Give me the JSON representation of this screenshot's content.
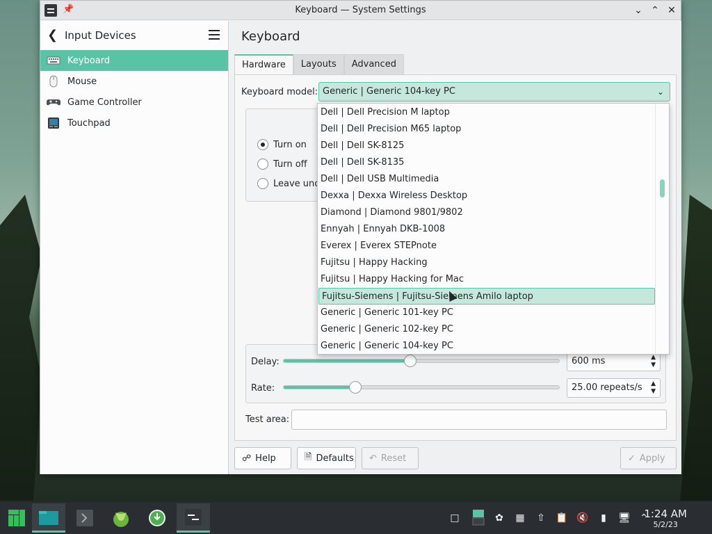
{
  "window": {
    "title": "Keyboard — System Settings"
  },
  "sidebar": {
    "title": "Input Devices",
    "items": [
      {
        "label": "Keyboard",
        "active": true
      },
      {
        "label": "Mouse",
        "active": false
      },
      {
        "label": "Game Controller",
        "active": false
      },
      {
        "label": "Touchpad",
        "active": false
      }
    ]
  },
  "main": {
    "title": "Keyboard",
    "tabs": [
      {
        "label": "Hardware",
        "active": true
      },
      {
        "label": "Layouts",
        "active": false
      },
      {
        "label": "Advanced",
        "active": false
      }
    ],
    "keyboard_model_label": "Keyboard model:",
    "keyboard_model_value": "Generic | Generic 104-key PC",
    "numlock": {
      "options": [
        "Turn on",
        "Turn off",
        "Leave unch"
      ],
      "selected": "Turn on"
    },
    "repeat": {
      "delay_label": "Delay:",
      "delay_value": "600 ms",
      "delay_fraction": 0.46,
      "rate_label": "Rate:",
      "rate_value": "25.00 repeats/s",
      "rate_fraction": 0.26
    },
    "test_area_label": "Test area:",
    "buttons": {
      "help": "Help",
      "defaults": "Defaults",
      "reset": "Reset",
      "apply": "Apply"
    }
  },
  "dropdown": {
    "items": [
      "Dell | Dell Precision M laptop",
      "Dell | Dell Precision M65 laptop",
      "Dell | Dell SK-8125",
      "Dell | Dell SK-8135",
      "Dell | Dell USB Multimedia",
      "Dexxa | Dexxa Wireless Desktop",
      "Diamond | Diamond 9801/9802",
      "Ennyah | Ennyah DKB-1008",
      "Everex | Everex STEPnote",
      "Fujitsu | Happy Hacking",
      "Fujitsu | Happy Hacking for Mac",
      "Fujitsu-Siemens | Fujitsu-Siemens Amilo laptop",
      "Generic | Generic 101-key PC",
      "Generic | Generic 102-key PC",
      "Generic | Generic 104-key PC"
    ],
    "highlighted_index": 11
  },
  "taskbar": {
    "clock_time": "1:24 AM",
    "clock_date": "5/2/23",
    "accent_color": "#58c3a5"
  }
}
